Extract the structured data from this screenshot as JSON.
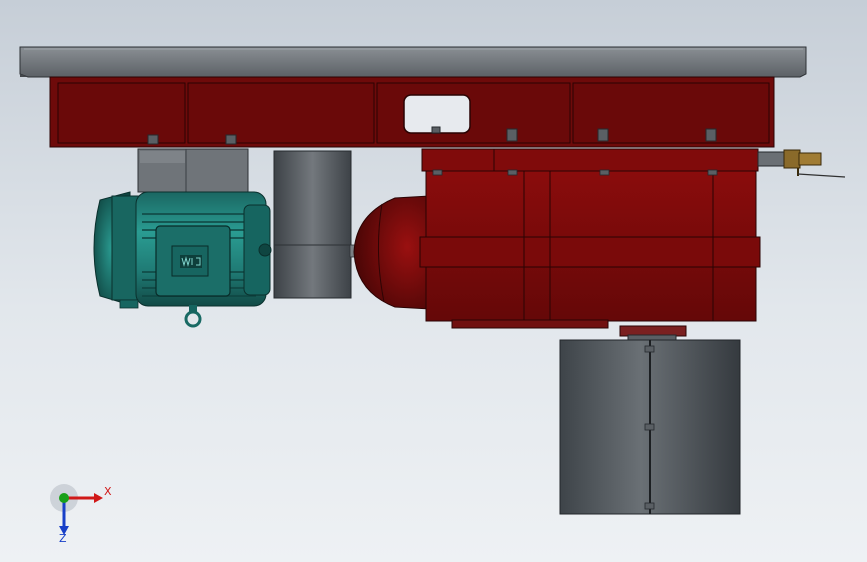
{
  "viewport": {
    "background_top": "#c6ced7",
    "background_bottom": "#eef1f4"
  },
  "colors": {
    "frame_red": "#6e0a0a",
    "frame_red_dark": "#4a0606",
    "gearbox_red": "#7a0a0a",
    "motor_teal": "#1f7a74",
    "steel_gray": "#595f66",
    "plate_gray": "#6e7378",
    "drum_gray": "#4a5055",
    "brass": "#8a6a2a"
  },
  "motor": {
    "nameplate_icon": "weg-logo-icon"
  },
  "triad": {
    "x_label": "X",
    "z_label": "Z",
    "x_color": "#d01818",
    "y_color": "#18a018",
    "z_color": "#1840c8"
  }
}
